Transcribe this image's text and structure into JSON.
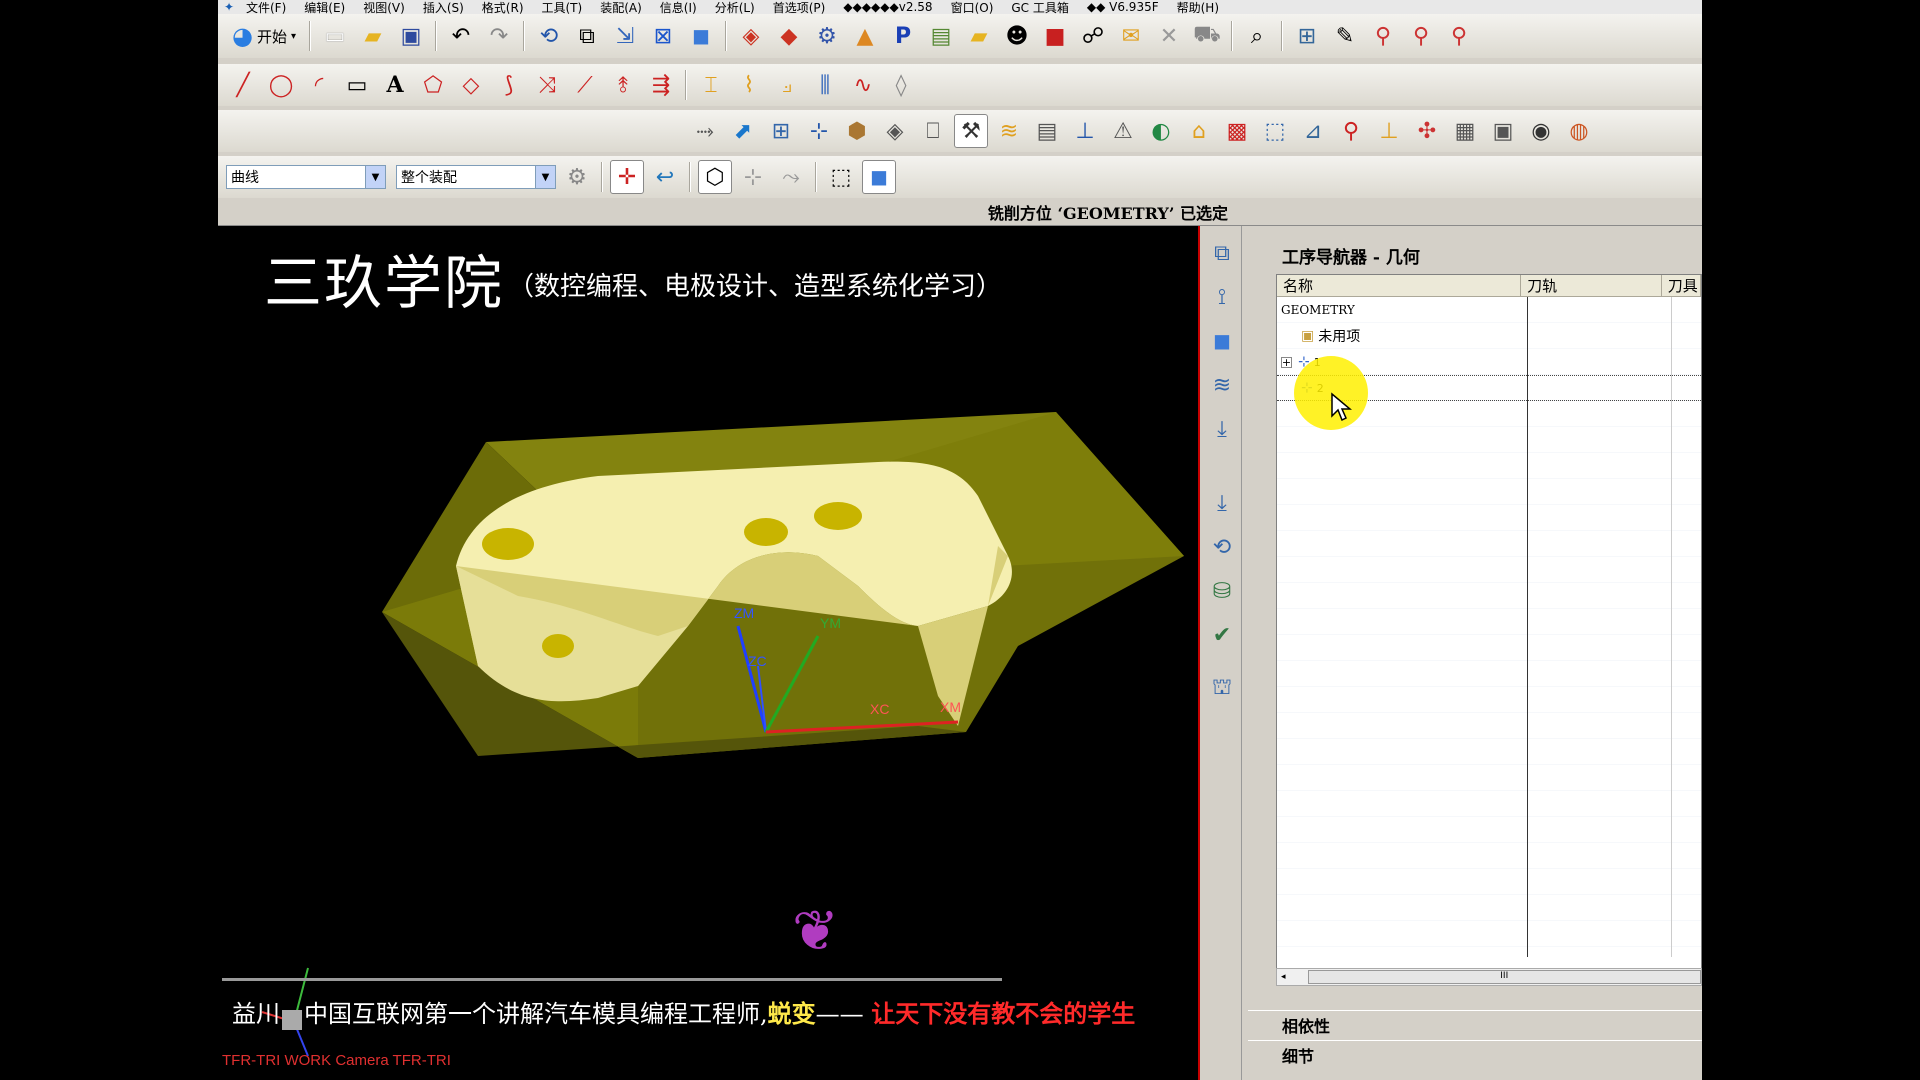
{
  "menu": [
    "文件(F)",
    "编辑(E)",
    "视图(V)",
    "插入(S)",
    "格式(R)",
    "工具(T)",
    "装配(A)",
    "信息(I)",
    "分析(L)",
    "首选项(P)",
    "◆◆◆◆◆◆v2.58",
    "窗口(O)",
    "GC 工具箱",
    "◆◆ V6.935F",
    "帮助(H)"
  ],
  "toolbar": {
    "start_label": "开始",
    "filter_select": "曲线",
    "assembly_select": "整个装配"
  },
  "status_text": "铣削方位 ‘GEOMETRY’ 已选定",
  "viewport": {
    "title": "三玖学院",
    "subtitle": "（数控编程、电极设计、造型系统化学习）",
    "caption_prefix": "中国互联网第一个讲解汽车模具编程工程师,",
    "caption_name": "蜕变",
    "caption_dash": "—— ",
    "caption_slogan": "让天下没有教不会的学生",
    "caption_lead": "益川",
    "camera": "TFR-TRI WORK Camera TFR-TRI",
    "axis_labels": {
      "zm": "ZM",
      "zc": "ZC",
      "ym": "YM",
      "xc": "XC",
      "xm": "XM"
    }
  },
  "navigator": {
    "title": "工序导航器 - 几何",
    "columns": [
      "名称",
      "刀轨",
      "刀具"
    ],
    "rows": [
      {
        "name": "GEOMETRY",
        "level": 0
      },
      {
        "name": "未用项",
        "level": 1
      },
      {
        "name": "1",
        "level": 1
      },
      {
        "name": "2",
        "level": 1
      }
    ],
    "scroll_grip": "III",
    "sections": [
      "相依性",
      "细节"
    ]
  }
}
